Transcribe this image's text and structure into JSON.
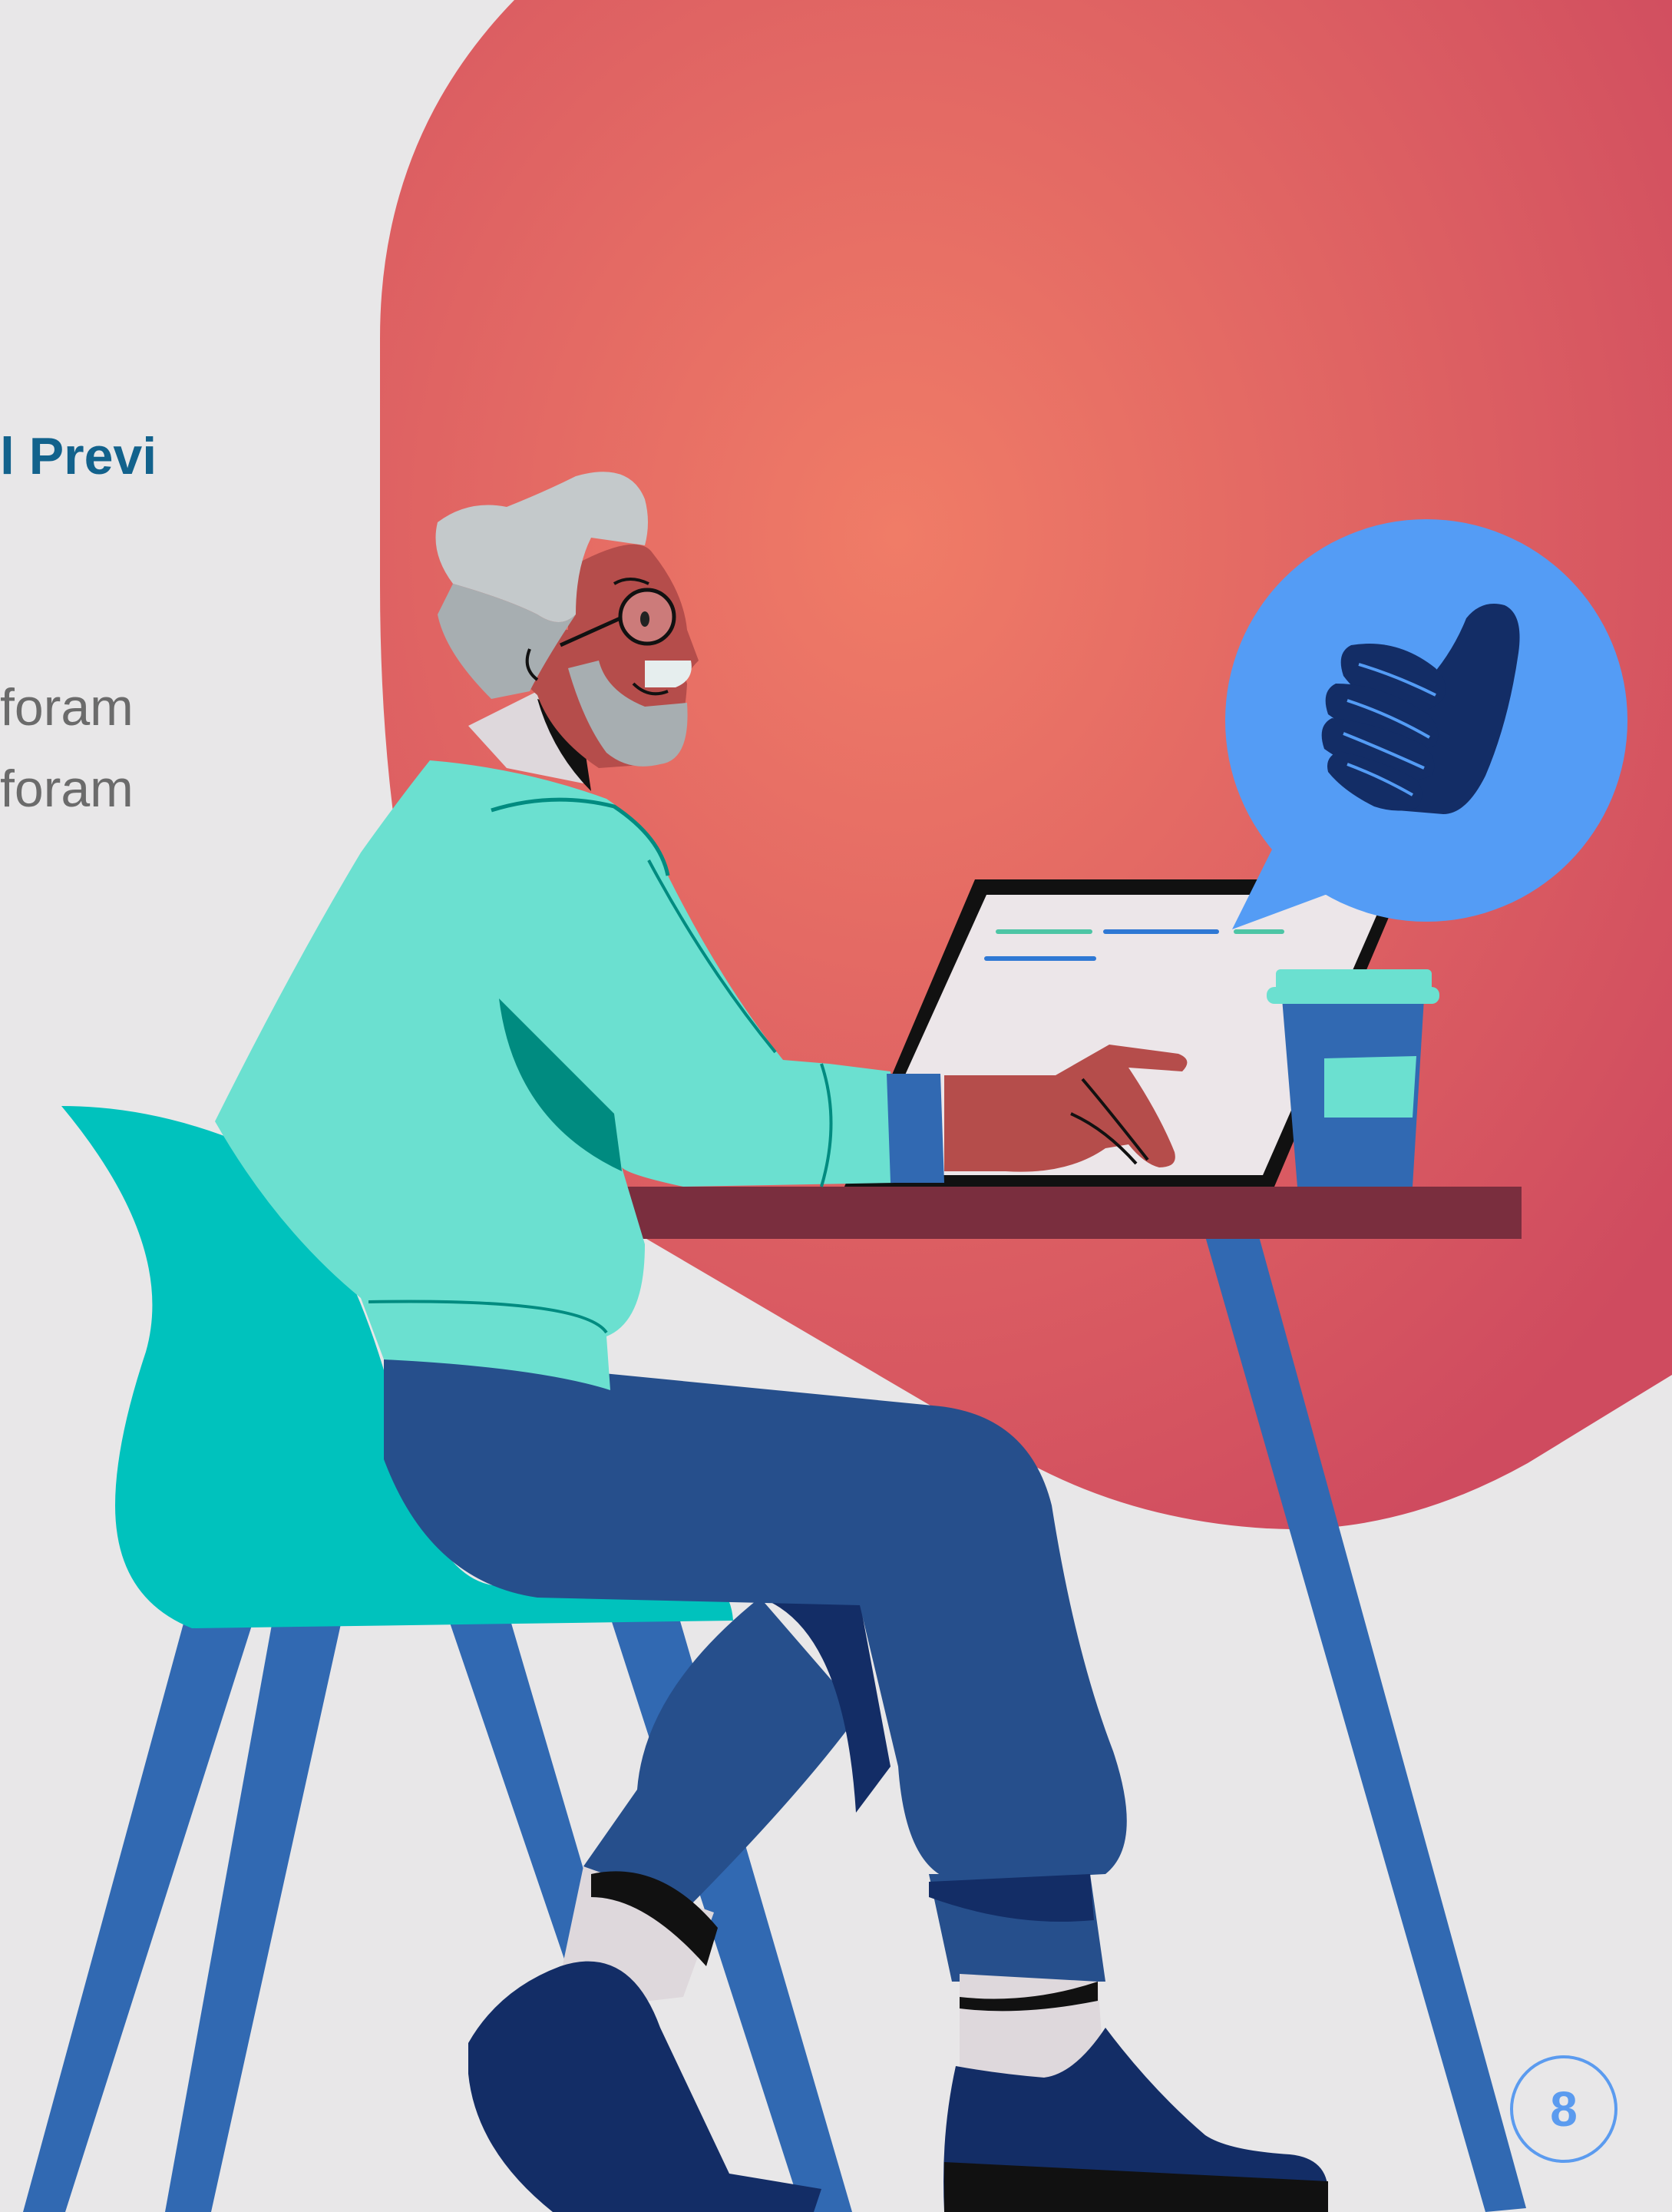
{
  "text": {
    "heading_fragment": "l Previ",
    "body_line_1_fragment": "foram",
    "body_line_2_fragment": "foram"
  },
  "page_number": "8",
  "colors": {
    "background": "#e8e7e8",
    "blob_gradient_center": "#f07c67",
    "blob_gradient_edge": "#cf4b5f",
    "heading": "#12628c",
    "body_text": "#6b6b6b",
    "badge": "#5b9bef",
    "shirt": "#6be0d0",
    "chair": "#00c2bd",
    "pants": "#264f8c",
    "table_top": "#7a2e3e",
    "furniture_legs": "#3169b2",
    "speech_bubble": "#549cf5",
    "thumb": "#132d66"
  },
  "illustration": {
    "subject": "older man with glasses working on laptop at desk",
    "icons": [
      "thumbs-up-icon",
      "coffee-cup",
      "laptop"
    ]
  }
}
